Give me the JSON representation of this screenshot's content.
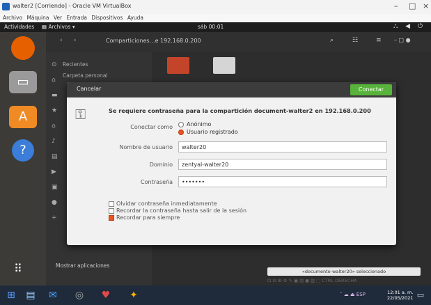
{
  "window": {
    "title": "walter2 [Corriendo] - Oracle VM VirtualBox",
    "controls": [
      "–",
      "□",
      "×"
    ]
  },
  "host_menu": [
    "Archivo",
    "Máquina",
    "Ver",
    "Entrada",
    "Dispositivos",
    "Ayuda"
  ],
  "gnome_topbar": {
    "activities": "Actividades",
    "app_menu": "Archivos",
    "clock": "sáb 00:01",
    "tray": "⛬ ◀ ⏻"
  },
  "dock": {
    "show_apps": "Mostrar aplicaciones",
    "items": [
      {
        "name": "firefox",
        "color": "#e66000",
        "glyph": "●"
      },
      {
        "name": "files",
        "color": "#9a9a9a",
        "glyph": "▭"
      },
      {
        "name": "software",
        "color": "#f08a24",
        "glyph": "A"
      },
      {
        "name": "help",
        "color": "#3b7dd8",
        "glyph": "?"
      }
    ]
  },
  "sidebar": {
    "items": [
      "Recientes",
      "Carpeta personal"
    ]
  },
  "breadcrumb": "Comparticiones…e 192.168.0.200",
  "dialog": {
    "cancel": "Cancelar",
    "connect": "Conectar",
    "prompt": "Se requiere contraseña para la compartición document-walter2 en 192.168.0.200",
    "connect_as_label": "Conectar como",
    "radio_anonymous": "Anónimo",
    "radio_registered": "Usuario registrado",
    "username_label": "Nombre de usuario",
    "username_value": "walter20",
    "domain_label": "Dominio",
    "domain_value": "zentyal-walter20",
    "password_label": "Contraseña",
    "password_value": "•••••••",
    "opt_forget": "Olvidar contraseña inmediatamente",
    "opt_until_logout": "Recordar la contraseña hasta salir de la sesión",
    "opt_forever": "Recordar para siempre"
  },
  "status": {
    "selection": "«documento-walter20» seleccionado",
    "vbox": "⊡ ⊟ ⊞ ⚙ ✎ ▣ ▤ ◼ ▥ ⬚ CTRL DERECHA"
  },
  "taskbar": {
    "time": "12:01 a. m.",
    "date": "22/05/2021",
    "tray": "ˆ ☁ ⏏ ESP"
  },
  "colors": {
    "ubuntu_orange": "#e95420",
    "connect_green": "#58b33a",
    "dock": "#3c3b37"
  }
}
